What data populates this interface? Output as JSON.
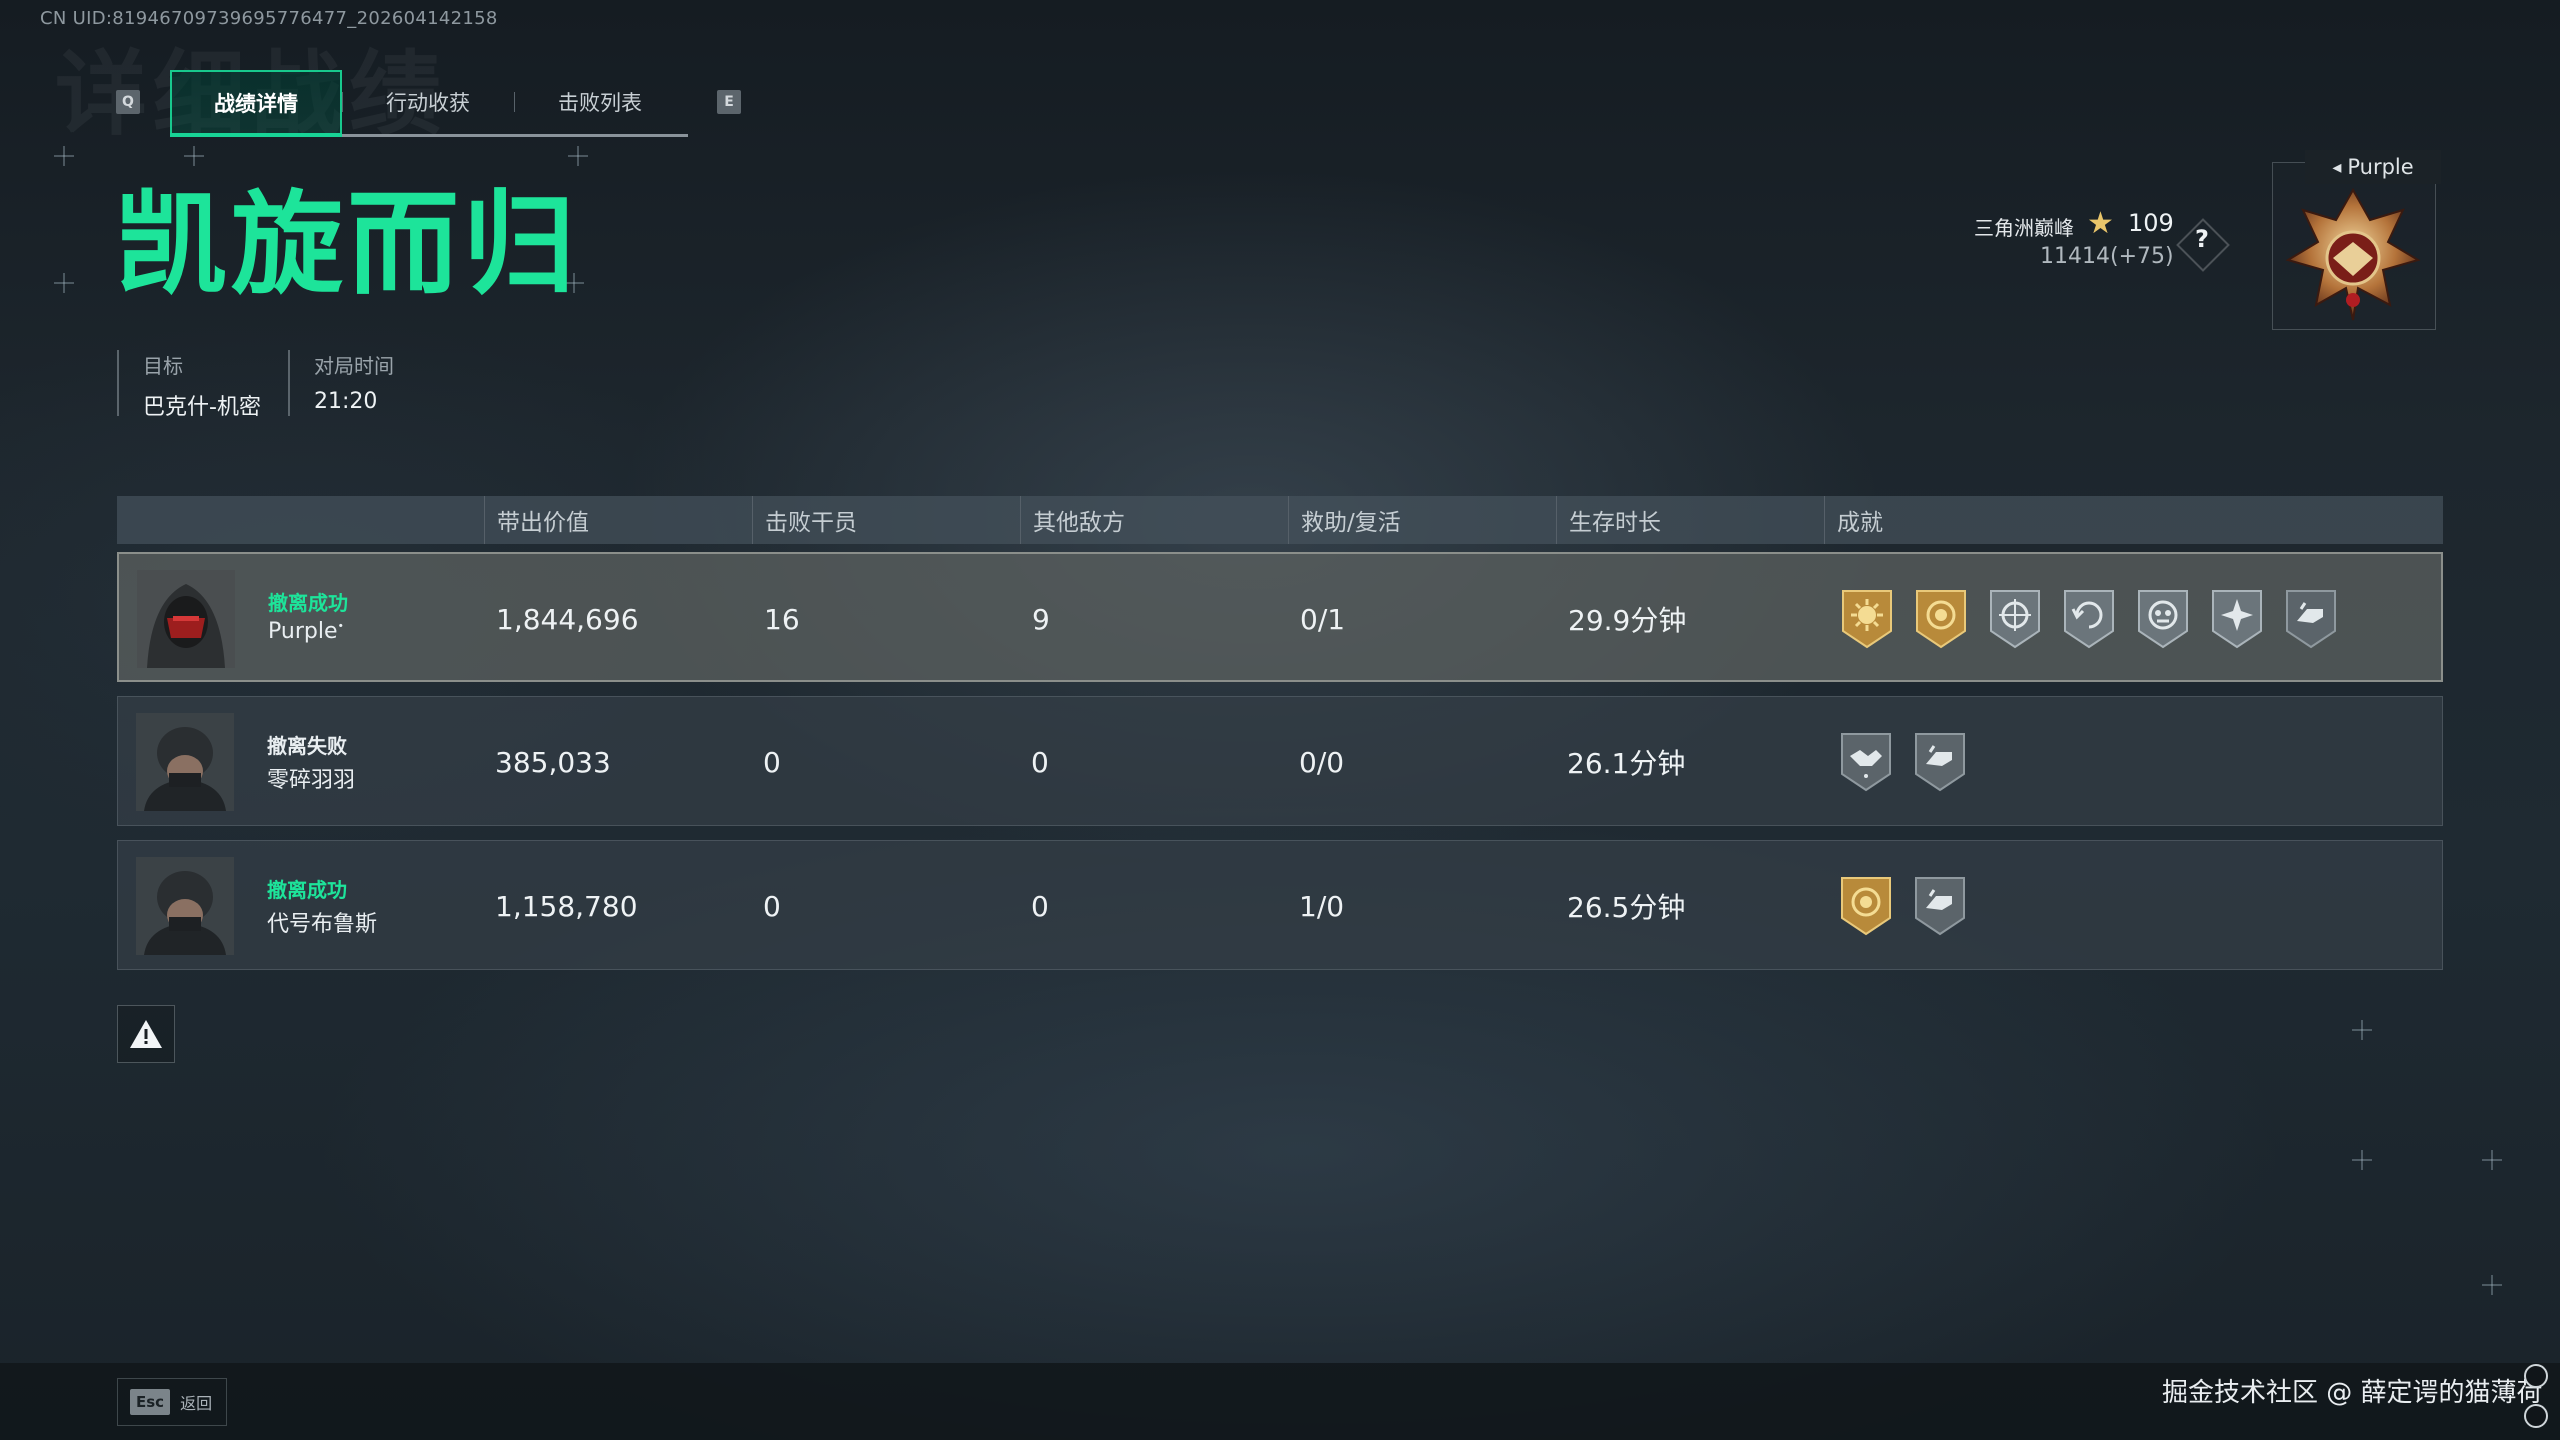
{
  "uid_text": "CN UID:8194670973969577647​7_202604142158",
  "ghost_title": "详细战绩",
  "tabs": {
    "left_key": "Q",
    "right_key": "E",
    "items": [
      {
        "label": "战绩详情"
      },
      {
        "label": "行动收获"
      },
      {
        "label": "击败列表"
      }
    ]
  },
  "result_title": "凯旋而归",
  "meta": {
    "target_label": "目标",
    "target_value": "巴克什-机密",
    "time_label": "对局时间",
    "time_value": "21:20"
  },
  "rank": {
    "name": "三角洲巅峰",
    "level": "109",
    "score": "11414(+75)",
    "help": "?",
    "player_badge_name": "Purple"
  },
  "table": {
    "headers": [
      "带出价值",
      "击败干员",
      "其他敌方",
      "救助/复活",
      "生存时长",
      "成就"
    ],
    "rows": [
      {
        "status": "撤离成功",
        "name": "Purple",
        "value": "1,844,696",
        "kills": "16",
        "other": "9",
        "assist": "0/1",
        "survival": "29.9分钟",
        "achievements": [
          "sun-gold-badge-icon",
          "coin-gold-badge-icon",
          "crosshair-badge-icon",
          "reload-badge-icon",
          "skull-badge-icon",
          "star-burst-badge-icon",
          "hand-badge-icon"
        ]
      },
      {
        "status": "撤离失败",
        "name": "零碎羽羽",
        "value": "385,033",
        "kills": "0",
        "other": "0",
        "assist": "0/0",
        "survival": "26.1分钟",
        "achievements": [
          "handshake-badge-icon",
          "hand-badge-icon"
        ]
      },
      {
        "status": "撤离成功",
        "name": "代号布鲁斯",
        "value": "1,158,780",
        "kills": "0",
        "other": "0",
        "assist": "1/0",
        "survival": "26.5分钟",
        "achievements": [
          "coin-gold-badge-icon",
          "hand-badge-icon"
        ]
      }
    ]
  },
  "footer": {
    "esc_key": "Esc",
    "esc_label": "返回",
    "watermark": "掘金技术社区 @ 薛定谔的猫薄荷"
  },
  "colors": {
    "accent_green": "#1de49a",
    "gold": "#e9c56a"
  }
}
